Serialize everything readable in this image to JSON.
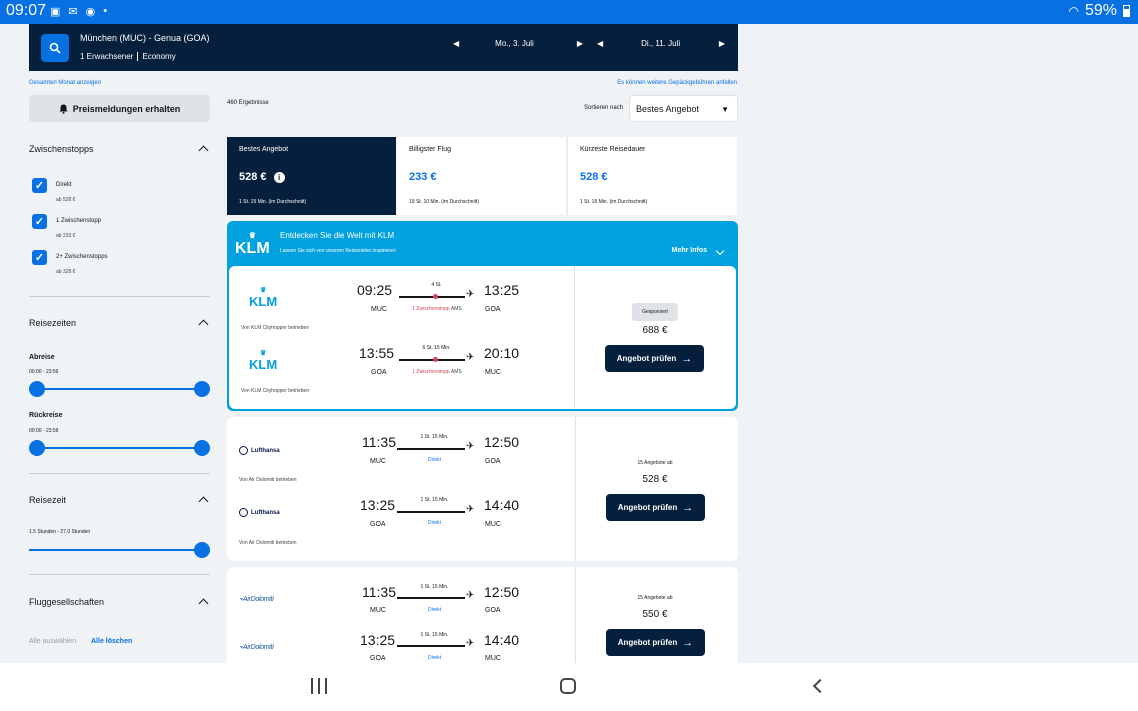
{
  "status": {
    "time": "09:07",
    "battery": "59%"
  },
  "search": {
    "route": "München (MUC) - Genua (GOA)",
    "passengers": "1 Erwachsener",
    "cabin": "Economy",
    "depart_date": "Mo., 3. Juli",
    "return_date": "Di., 11. Juli"
  },
  "links": {
    "month": "Gesamten Monat anzeigen",
    "baggage": "Es können weitere Gepäckgebühren anfallen"
  },
  "price_alert": "Preismeldungen erhalten",
  "results_count": "460 Ergebnisse",
  "sort": {
    "label": "Sortieren nach",
    "value": "Bestes Angebot"
  },
  "filters": {
    "stops": {
      "title": "Zwischenstopps",
      "items": [
        {
          "label": "Direkt",
          "sub": "ab 528 €"
        },
        {
          "label": "1 Zwischenstopp",
          "sub": "ab 233 €"
        },
        {
          "label": "2+ Zwischenstopps",
          "sub": "ab 328 €"
        }
      ]
    },
    "times": {
      "title": "Reisezeiten",
      "depart": "Abreise",
      "depart_range": "00:00 - 23:59",
      "return": "Rückreise",
      "return_range": "00:00 - 23:59"
    },
    "duration": {
      "title": "Reisezeit",
      "range": "1.5 Stunden - 27.0 Stunden"
    },
    "airlines": {
      "title": "Fluggesellschaften",
      "select_all": "Alle auswählen",
      "clear_all": "Alle löschen"
    }
  },
  "tabs": [
    {
      "label": "Bestes Angebot",
      "price": "528 €",
      "duration": "1 St. 15 Min. (im Durchschnitt)"
    },
    {
      "label": "Billigster Flug",
      "price": "233 €",
      "duration": "19 St. 10 Min. (im Durchschnitt)"
    },
    {
      "label": "Kürzeste Reisedauer",
      "price": "528 €",
      "duration": "1 St. 15 Min. (im Durchschnitt)"
    }
  ],
  "klm_ad": {
    "logo": "KLM",
    "title": "Entdecken Sie die Welt mit KLM",
    "subtitle": "Lassen Sie sich von unseren Reisezielen inspirieren",
    "more": "Mehr Infos"
  },
  "results": [
    {
      "logo": "KLM",
      "badge": "Gesponsert",
      "price": "688 €",
      "cta": "Angebot prüfen",
      "legs": [
        {
          "dep": "09:25",
          "arr": "13:25",
          "from": "MUC",
          "to": "GOA",
          "dur": "4 St.",
          "stops": "1 Zwischenstopp",
          "via": "AMS",
          "op": "Von KLM Cityhopper betrieben"
        },
        {
          "dep": "13:55",
          "arr": "20:10",
          "from": "GOA",
          "to": "MUC",
          "dur": "6 St. 15 Min.",
          "stops": "1 Zwischenstopp",
          "via": "AMS",
          "op": "Von KLM Cityhopper betrieben"
        }
      ]
    },
    {
      "logo": "Lufthansa",
      "offers": "15 Angebote ab",
      "price": "528 €",
      "cta": "Angebot prüfen",
      "legs": [
        {
          "dep": "11:35",
          "arr": "12:50",
          "from": "MUC",
          "to": "GOA",
          "dur": "1 St. 15 Min.",
          "stops": "Direkt",
          "op": "Von Air Dolomiti betrieben"
        },
        {
          "dep": "13:25",
          "arr": "14:40",
          "from": "GOA",
          "to": "MUC",
          "dur": "1 St. 15 Min.",
          "stops": "Direkt",
          "op": "Von Air Dolomiti betrieben"
        }
      ]
    },
    {
      "logo": "AirDolomiti",
      "offers": "15 Angebote ab",
      "price": "550 €",
      "cta": "Angebot prüfen",
      "legs": [
        {
          "dep": "11:35",
          "arr": "12:50",
          "from": "MUC",
          "to": "GOA",
          "dur": "1 St. 15 Min.",
          "stops": "Direkt"
        },
        {
          "dep": "13:25",
          "arr": "14:40",
          "from": "GOA",
          "to": "MUC",
          "dur": "1 St. 15 Min.",
          "stops": "Direkt"
        }
      ]
    }
  ],
  "colors": {
    "brand": "#0770e3",
    "navy": "#05203c",
    "stop": "#d1435b",
    "klm": "#00a1de"
  }
}
